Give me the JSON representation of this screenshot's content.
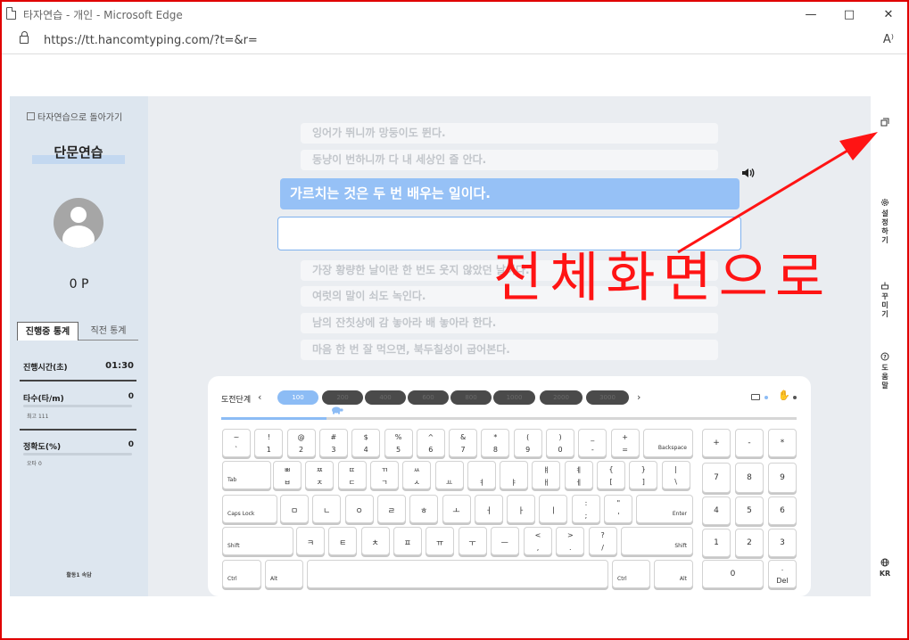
{
  "window": {
    "title": "타자연습 - 개인 - Microsoft Edge",
    "url": "https://tt.hancomtyping.com/?t=&r=",
    "read_aloud": "A⁾"
  },
  "sidebar": {
    "back_label": "타자연습으로 돌아가기",
    "title": "단문연습",
    "points": "0 P",
    "tabs": [
      {
        "label": "진행중 통계",
        "active": true
      },
      {
        "label": "직전 통계",
        "active": false
      }
    ],
    "stats": [
      {
        "label": "진행시간(초)",
        "value": "01:30"
      },
      {
        "label": "타수(타/m)",
        "value": "0",
        "sub": "최고 111"
      },
      {
        "label": "정확도(%)",
        "value": "0",
        "sub": "오타 0"
      }
    ],
    "footer": "활동1 속담"
  },
  "practice": {
    "previous": [
      "잉어가 뛰니까 망둥이도 뛴다.",
      "동냥이 번하니까 다 내 세상인 줄 안다."
    ],
    "current": "가르치는 것은 두 번 배우는 일이다.",
    "upcoming": [
      "가장 황량한 날이란 한 번도 웃지 않았던 날이다.",
      "여럿의 말이 쇠도 녹인다.",
      "남의 잔칫상에 감 놓아라 배 놓아라 한다.",
      "마음 한 번 잘 먹으면, 북두칠성이 굽어본다."
    ]
  },
  "keyboard_panel": {
    "stage_label": "도전단계",
    "prev": "‹",
    "next": "›",
    "stages": [
      "100",
      "200",
      "400",
      "600",
      "800",
      "1000",
      "2000",
      "3000"
    ],
    "active_stage": "100",
    "progress": 0.183,
    "colors": {
      "accent": "#8cbcf5",
      "inactive": "#4a4a4a"
    }
  },
  "keys": {
    "row1": [
      [
        "~",
        "`"
      ],
      [
        "!",
        "1"
      ],
      [
        "@",
        "2"
      ],
      [
        "#",
        "3"
      ],
      [
        "$",
        "4"
      ],
      [
        "%",
        "5"
      ],
      [
        "^",
        "6"
      ],
      [
        "&",
        "7"
      ],
      [
        "*",
        "8"
      ],
      [
        "(",
        "9"
      ],
      [
        ")",
        "0"
      ],
      [
        "_",
        "-"
      ],
      [
        "+",
        "="
      ]
    ],
    "backspace": "Backspace",
    "tab": "Tab",
    "row2": [
      [
        "ㅃ",
        "ㅂ"
      ],
      [
        "ㅉ",
        "ㅈ"
      ],
      [
        "ㄸ",
        "ㄷ"
      ],
      [
        "ㄲ",
        "ㄱ"
      ],
      [
        "ㅆ",
        "ㅅ"
      ],
      [
        "",
        "ㅛ"
      ],
      [
        "",
        "ㅕ"
      ],
      [
        "",
        "ㅑ"
      ],
      [
        "ㅒ",
        "ㅐ"
      ],
      [
        "ㅖ",
        "ㅔ"
      ],
      [
        "{",
        "["
      ],
      [
        "}",
        "]"
      ],
      [
        "|",
        "\\"
      ]
    ],
    "capslock": "Caps Lock",
    "row3": [
      "ㅁ",
      "ㄴ",
      "ㅇ",
      "ㄹ",
      "ㅎ",
      "ㅗ",
      "ㅓ",
      "ㅏ",
      "ㅣ"
    ],
    "row3_punct": [
      [
        ":",
        ";"
      ],
      [
        "\"",
        "'"
      ]
    ],
    "enter": "Enter",
    "shift": "Shift",
    "row4": [
      "ㅋ",
      "ㅌ",
      "ㅊ",
      "ㅍ",
      "ㅠ",
      "ㅜ",
      "ㅡ"
    ],
    "row4_punct": [
      [
        "<",
        ","
      ],
      [
        ">",
        "."
      ],
      [
        "?",
        "/"
      ]
    ],
    "ctrl": "Ctrl",
    "alt": "Alt",
    "numpad_row1": [
      "+",
      "-",
      "*"
    ],
    "numpad_row2": [
      "7",
      "8",
      "9"
    ],
    "numpad_row3": [
      "4",
      "5",
      "6"
    ],
    "numpad_row4": [
      "1",
      "2",
      "3"
    ],
    "numpad_zero": "0",
    "numpad_dot": ".",
    "numpad_del": "Del"
  },
  "rightbar": {
    "settings": "설정하기",
    "decorate": "꾸미기",
    "help": "도움말",
    "lang": "KR"
  },
  "annotation": {
    "text": "전체화면으로",
    "color": "#ff1414"
  }
}
